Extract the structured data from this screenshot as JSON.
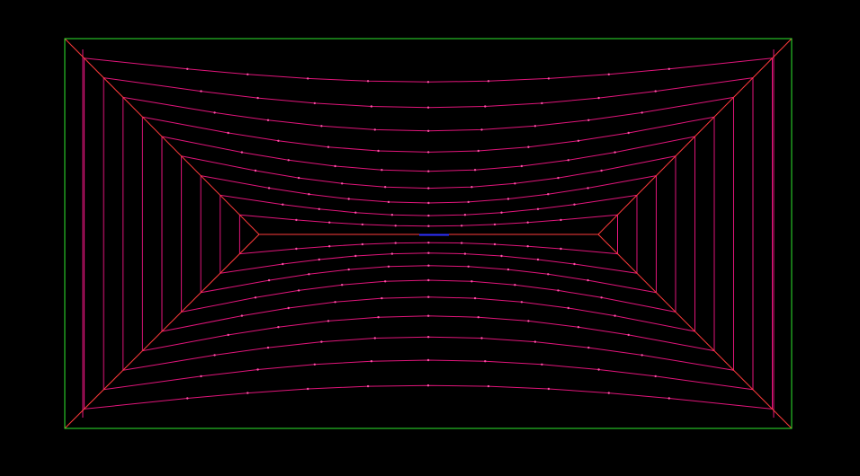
{
  "colors": {
    "background": "#000000",
    "boundary": "#2ee62e",
    "diagonal": "#ff3b3b",
    "contour": "#e0157a",
    "node": "#ff4fa8",
    "center_highlight": "#3030ff"
  },
  "diagram": {
    "kind": "wireframe-mesh",
    "levels": 9,
    "contour_nodes_per_side": 8,
    "rays_per_side": 4,
    "has_center_highlight": true
  }
}
